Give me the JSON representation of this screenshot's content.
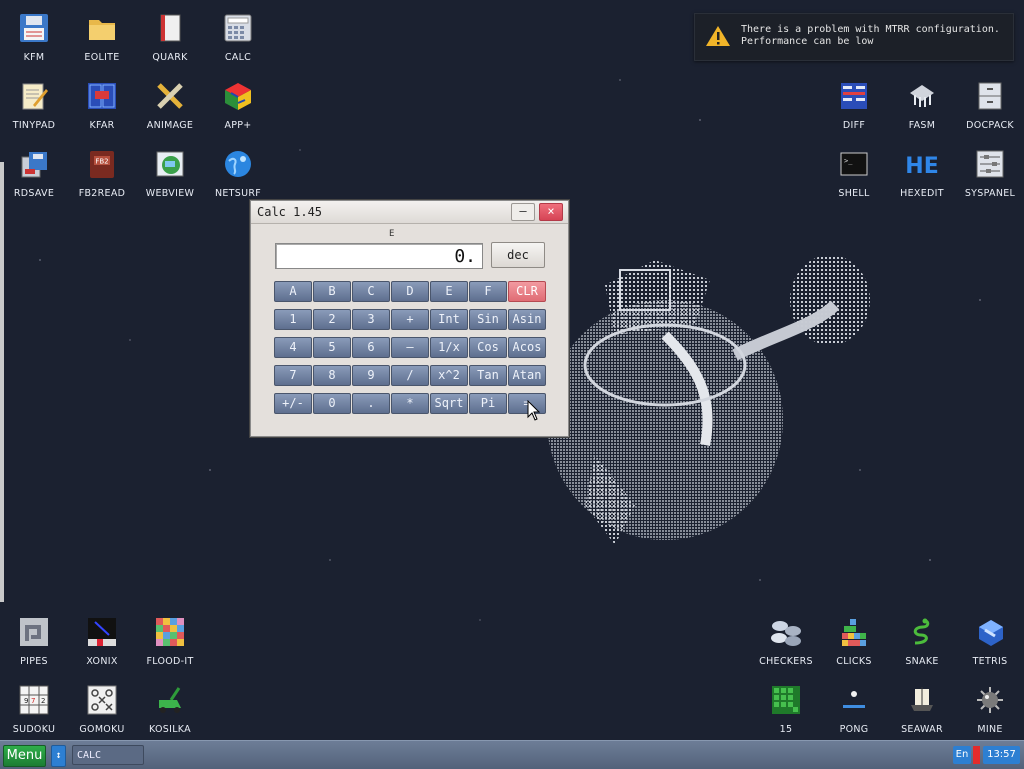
{
  "desktop": {
    "icons": [
      {
        "label": "KFM",
        "icon": "floppy-icon"
      },
      {
        "label": "EOLITE",
        "icon": "folder-icon"
      },
      {
        "label": "QUARK",
        "icon": "book-icon"
      },
      {
        "label": "CALC",
        "icon": "calculator-icon"
      },
      {
        "label": "TINYPAD",
        "icon": "notepad-icon"
      },
      {
        "label": "KFAR",
        "icon": "kfar-icon"
      },
      {
        "label": "ANIMAGE",
        "icon": "pencil-ruler-icon"
      },
      {
        "label": "APP+",
        "icon": "cube-icon"
      },
      {
        "label": "RDSAVE",
        "icon": "rdsave-icon"
      },
      {
        "label": "FB2READ",
        "icon": "fb2-book-icon"
      },
      {
        "label": "WEBVIEW",
        "icon": "webview-icon"
      },
      {
        "label": "NETSURF",
        "icon": "globe-icon"
      },
      {
        "label": "DIFF",
        "icon": "diff-icon"
      },
      {
        "label": "FASM",
        "icon": "fasm-icon"
      },
      {
        "label": "DOCPACK",
        "icon": "cabinet-icon"
      },
      {
        "label": "SHELL",
        "icon": "terminal-icon"
      },
      {
        "label": "HEXEDIT",
        "icon": "hex-icon"
      },
      {
        "label": "SYSPANEL",
        "icon": "sliders-icon"
      },
      {
        "label": "PIPES",
        "icon": "pipes-icon"
      },
      {
        "label": "XONIX",
        "icon": "xonix-icon"
      },
      {
        "label": "FLOOD-IT",
        "icon": "flood-grid-icon"
      },
      {
        "label": "SUDOKU",
        "icon": "sudoku-icon"
      },
      {
        "label": "GOMOKU",
        "icon": "gomoku-icon"
      },
      {
        "label": "KOSILKA",
        "icon": "lawnmower-icon"
      },
      {
        "label": "CHECKERS",
        "icon": "checkers-icon"
      },
      {
        "label": "CLICKS",
        "icon": "clicks-icon"
      },
      {
        "label": "SNAKE",
        "icon": "snake-icon"
      },
      {
        "label": "TETRIS",
        "icon": "tetris-icon"
      },
      {
        "label": "15",
        "icon": "fifteen-icon"
      },
      {
        "label": "PONG",
        "icon": "pong-icon"
      },
      {
        "label": "SEAWAR",
        "icon": "seawar-icon"
      },
      {
        "label": "MINE",
        "icon": "mine-icon"
      }
    ]
  },
  "notification": {
    "line1": "There is a problem with MTRR configuration.",
    "line2": "Performance can be low",
    "icon": "warning-icon",
    "color": "#f0b429"
  },
  "calc": {
    "title": "Calc 1.45",
    "e_indicator": "E",
    "display": "0.",
    "mode": "dec",
    "minimize": "–",
    "close": "×",
    "rows": [
      [
        "A",
        "B",
        "C",
        "D",
        "E",
        "F",
        "CLR"
      ],
      [
        "1",
        "2",
        "3",
        "+",
        "Int",
        "Sin",
        "Asin"
      ],
      [
        "4",
        "5",
        "6",
        "–",
        "1/x",
        "Cos",
        "Acos"
      ],
      [
        "7",
        "8",
        "9",
        "/",
        "x^2",
        "Tan",
        "Atan"
      ],
      [
        "+/-",
        "0",
        ".",
        "*",
        "Sqrt",
        "Pi",
        "="
      ]
    ],
    "clr_color": "#e06c74",
    "key_color": "#6b7c9c"
  },
  "taskbar": {
    "menu": "Menu",
    "switch": "↕",
    "task": "CALC",
    "lang": "En",
    "clock": "13:57"
  }
}
